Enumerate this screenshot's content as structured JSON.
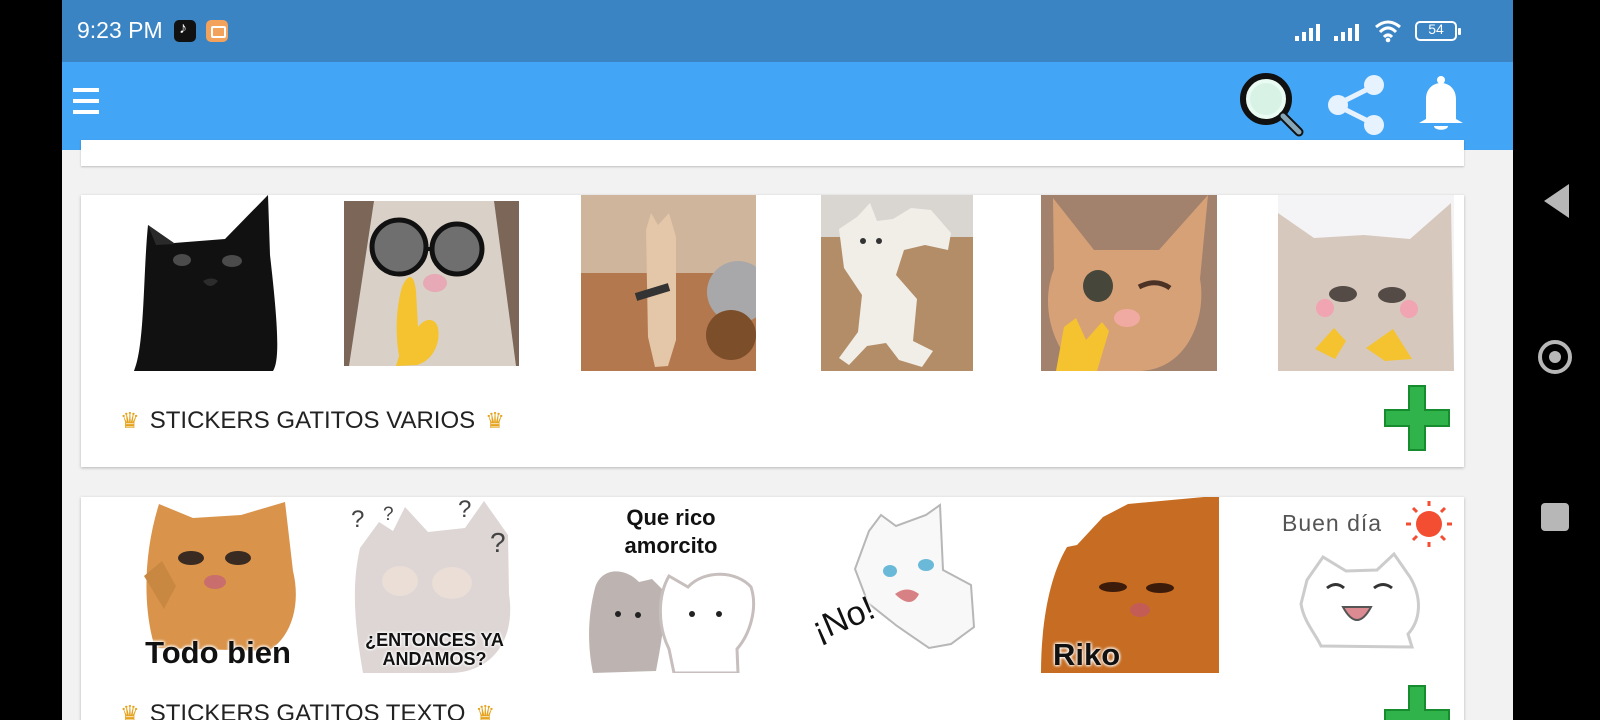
{
  "status_bar": {
    "time": "9:23 PM",
    "battery": "54",
    "icons": [
      "tiktok-icon",
      "mail-icon",
      "signal-icon",
      "signal-icon",
      "wifi-icon",
      "battery-icon"
    ]
  },
  "app_bar": {
    "icons": [
      "menu-icon",
      "search-icon",
      "share-icon",
      "bell-icon"
    ]
  },
  "packs": [
    {
      "title": "STICKERS GATITOS VARIOS",
      "stickers": [
        {
          "name": "black-cat-sticker"
        },
        {
          "name": "cat-with-glasses-sticker"
        },
        {
          "name": "standing-cat-with-knife-sticker"
        },
        {
          "name": "white-cat-standing-sticker"
        },
        {
          "name": "winking-cat-sticker"
        },
        {
          "name": "fluffy-cat-pointing-sticker"
        }
      ]
    },
    {
      "title": "STICKERS GATITOS TEXTO",
      "stickers": [
        {
          "name": "todo-bien-sticker",
          "caption": "Todo bien"
        },
        {
          "name": "entonces-ya-andamos-sticker",
          "caption": "¿ENTONCES YA ANDAMOS?"
        },
        {
          "name": "que-rico-amorcito-sticker",
          "caption": "Que rico amorcito"
        },
        {
          "name": "no-sticker",
          "caption": "¡No!"
        },
        {
          "name": "riko-sticker",
          "caption": "Riko"
        },
        {
          "name": "buen-dia-sticker",
          "caption": "Buen día"
        }
      ]
    }
  ],
  "colors": {
    "status_bar": "#3a84c4",
    "app_bar": "#42a5f5",
    "add_button": "#2fb34a"
  }
}
